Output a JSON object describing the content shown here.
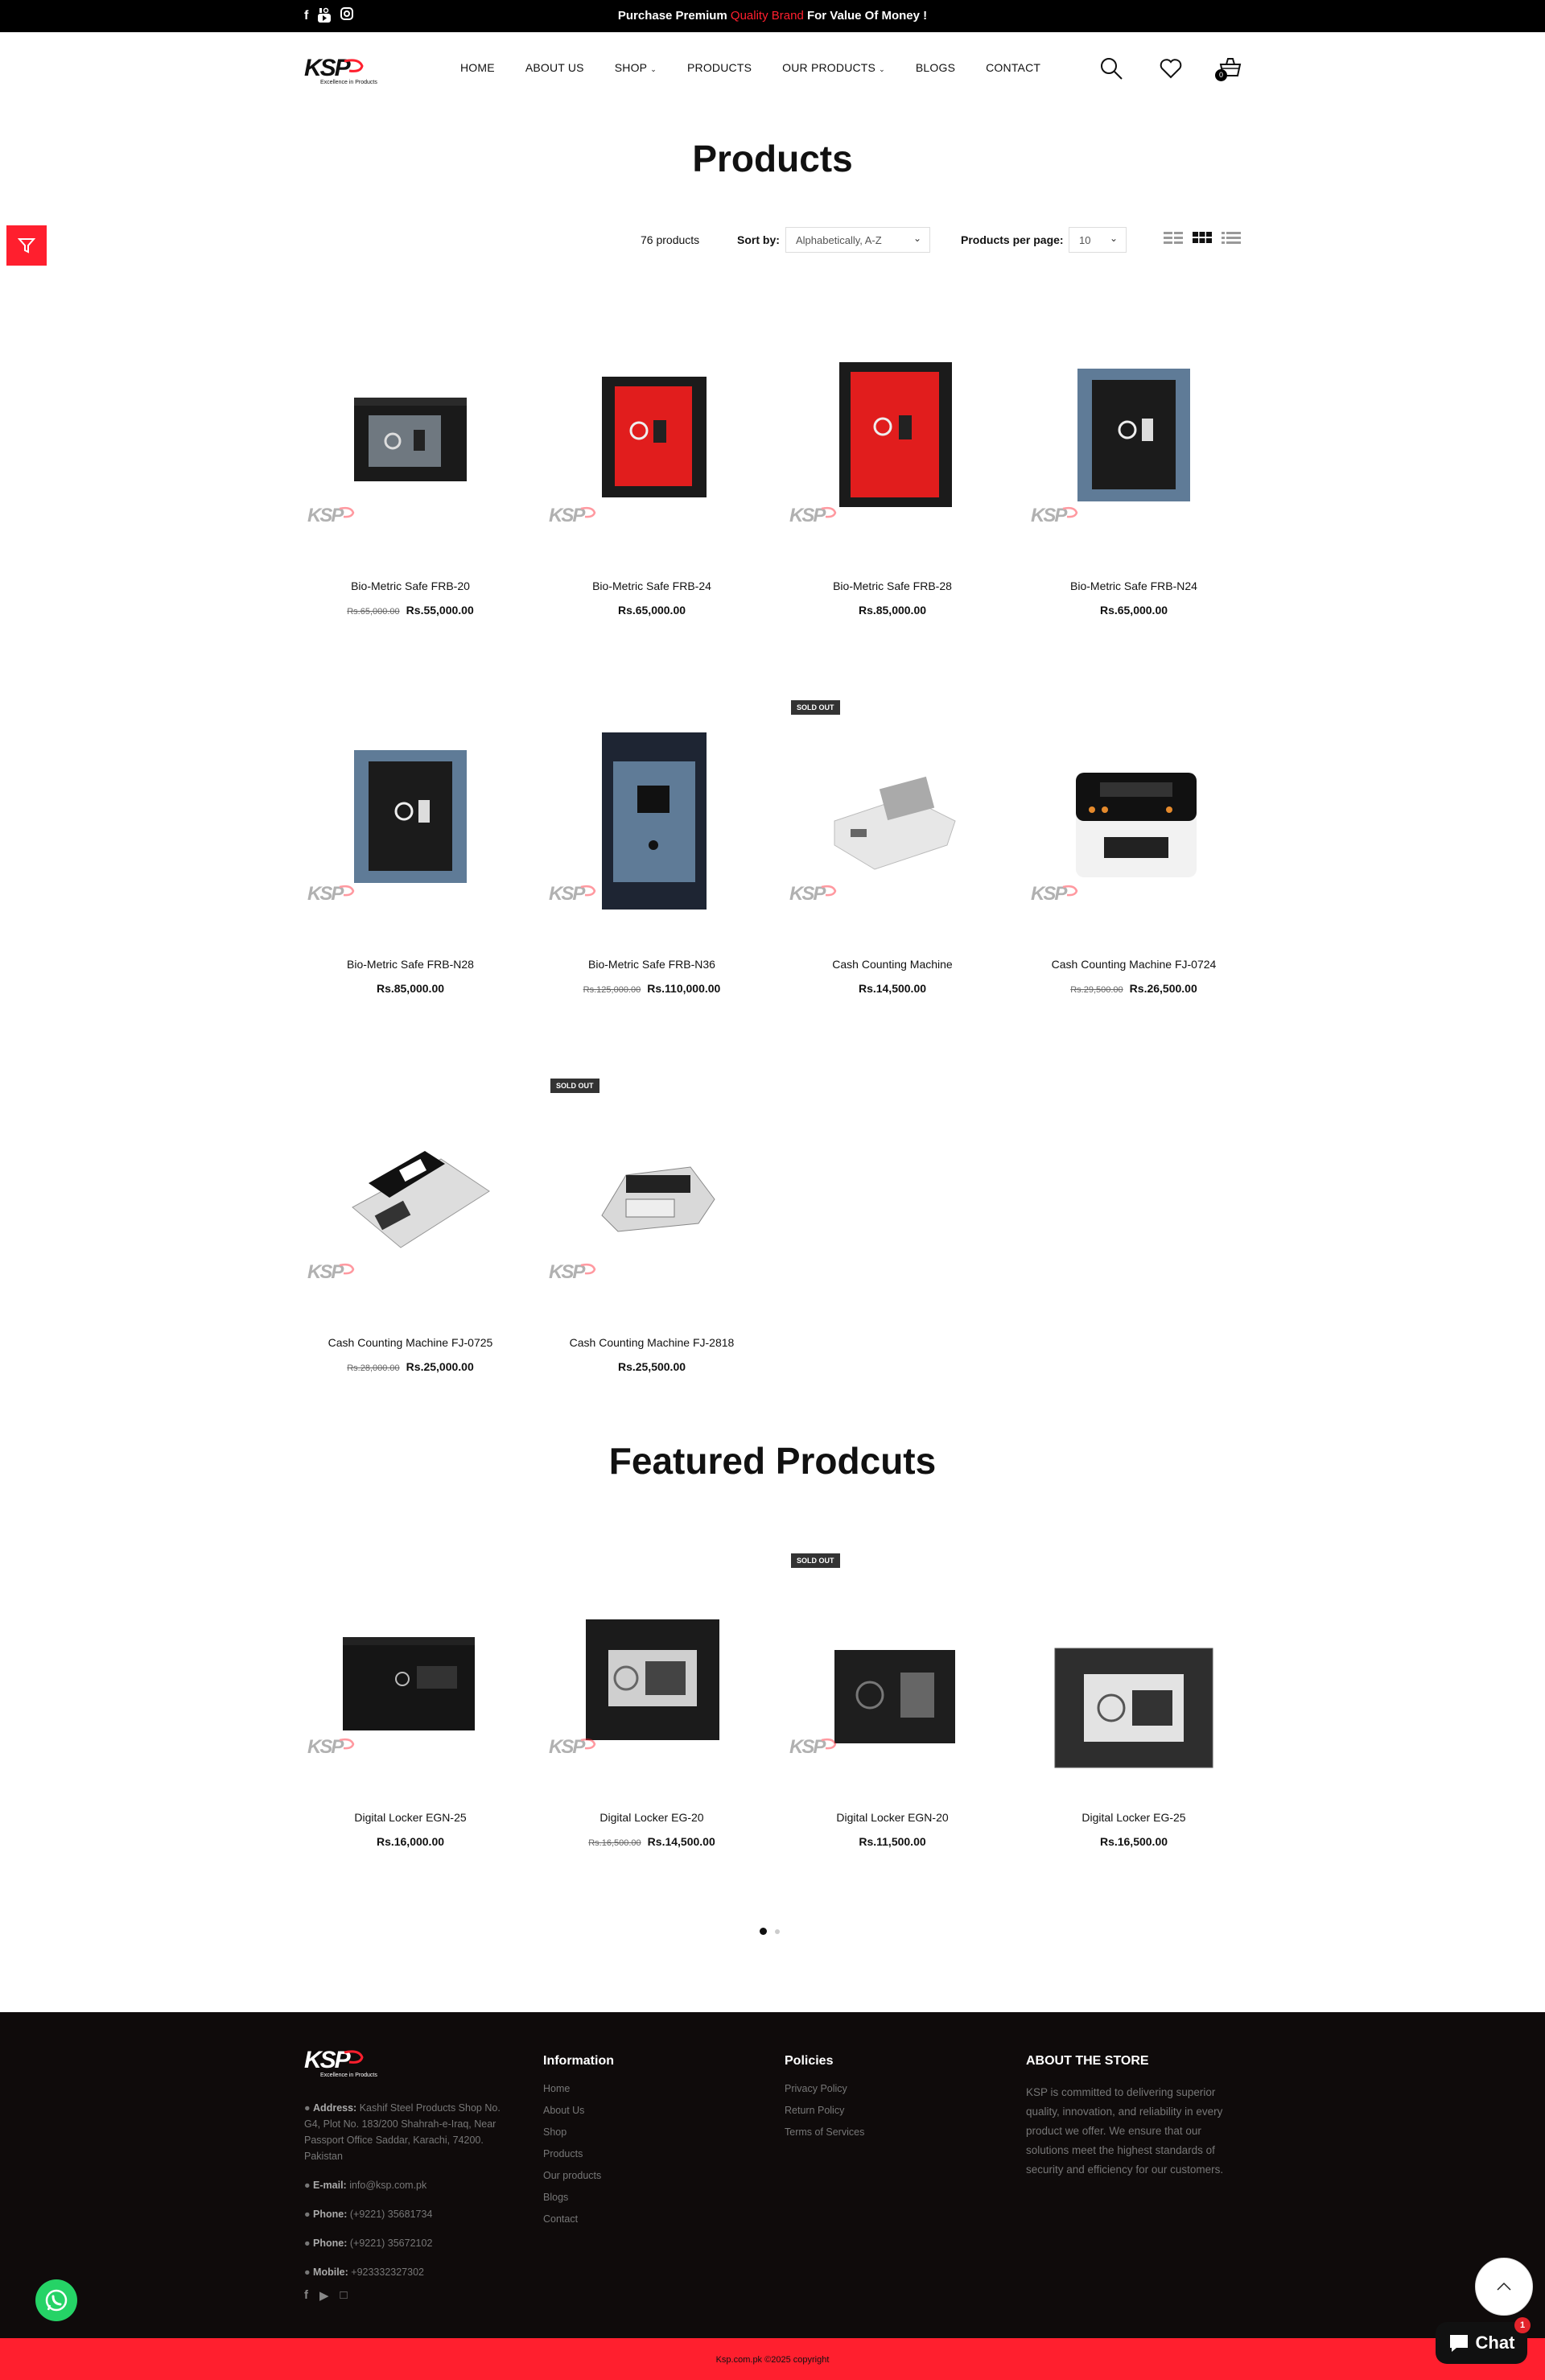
{
  "topbar": {
    "social": [
      "facebook-icon",
      "youtube-icon",
      "instagram-icon"
    ],
    "promo_before": "Purchase Premium ",
    "promo_highlight": "Quality Brand",
    "promo_after": " For Value Of Money !",
    "accent": "#ff1f2e"
  },
  "header": {
    "logo_text": "KSP",
    "logo_tagline": "Excellence in Products",
    "nav": [
      "HOME",
      "ABOUT US",
      "SHOP",
      "PRODUCTS",
      "OUR PRODUCTS",
      "BLOGS",
      "CONTACT"
    ],
    "cart_count": "0"
  },
  "page": {
    "title": "Products",
    "product_count": "76 products",
    "sort_label": "Sort by:",
    "sort_value": "Alphabetically, A-Z",
    "per_page_label": "Products per page:",
    "per_page_value": "10"
  },
  "products": [
    {
      "name": "Bio-Metric Safe FRB-20",
      "old_price": "Rs.65,000.00",
      "price": "Rs.55,000.00",
      "sold_out": false
    },
    {
      "name": "Bio-Metric Safe FRB-24",
      "old_price": "",
      "price": "Rs.65,000.00",
      "sold_out": false
    },
    {
      "name": "Bio-Metric Safe FRB-28",
      "old_price": "",
      "price": "Rs.85,000.00",
      "sold_out": false
    },
    {
      "name": "Bio-Metric Safe FRB-N24",
      "old_price": "",
      "price": "Rs.65,000.00",
      "sold_out": false
    },
    {
      "name": "Bio-Metric Safe FRB-N28",
      "old_price": "",
      "price": "Rs.85,000.00",
      "sold_out": false
    },
    {
      "name": "Bio-Metric Safe FRB-N36",
      "old_price": "Rs.125,000.00",
      "price": "Rs.110,000.00",
      "sold_out": false
    },
    {
      "name": "Cash Counting Machine",
      "old_price": "",
      "price": "Rs.14,500.00",
      "sold_out": true
    },
    {
      "name": "Cash Counting Machine FJ-0724",
      "old_price": "Rs.29,500.00",
      "price": "Rs.26,500.00",
      "sold_out": false
    },
    {
      "name": "Cash Counting Machine FJ-0725",
      "old_price": "Rs.28,000.00",
      "price": "Rs.25,000.00",
      "sold_out": false
    },
    {
      "name": "Cash Counting Machine FJ-2818",
      "old_price": "",
      "price": "Rs.25,500.00",
      "sold_out": true
    }
  ],
  "sold_out_label": "SOLD OUT",
  "featured": {
    "title": "Featured Prodcuts",
    "items": [
      {
        "name": "Digital Locker EGN-25",
        "old_price": "",
        "price": "Rs.16,000.00",
        "sold_out": false
      },
      {
        "name": "Digital Locker EG-20",
        "old_price": "Rs.16,500.00",
        "price": "Rs.14,500.00",
        "sold_out": false
      },
      {
        "name": "Digital Locker EGN-20",
        "old_price": "",
        "price": "Rs.11,500.00",
        "sold_out": true
      },
      {
        "name": "Digital Locker EG-25",
        "old_price": "",
        "price": "Rs.16,500.00",
        "sold_out": false
      }
    ]
  },
  "footer": {
    "address_label": "Address:",
    "address": "Kashif Steel Products Shop No. G4, Plot No. 183/200 Shahrah-e-Iraq, Near Passport Office Saddar, Karachi, 74200. Pakistan",
    "email_label": "E-mail:",
    "email": "info@ksp.com.pk",
    "phone_label": "Phone:",
    "phone1": "(+9221) 35681734",
    "phone2": "(+9221) 35672102",
    "mobile_label": "Mobile:",
    "mobile": "+923332327302",
    "information_title": "Information",
    "information_links": [
      "Home",
      "About Us",
      "Shop",
      "Products",
      "Our products",
      "Blogs",
      "Contact"
    ],
    "policies_title": "Policies",
    "policies_links": [
      "Privacy Policy",
      "Return Policy",
      "Terms of Services"
    ],
    "about_title": "ABOUT THE STORE",
    "about_text": "KSP is committed to delivering superior quality, innovation, and reliability in every product we offer. We ensure that our solutions meet the highest standards of security and efficiency for our customers.",
    "copyright": "Ksp.com.pk ©2025 copyright"
  },
  "chat": {
    "label": "Chat",
    "badge": "1"
  }
}
